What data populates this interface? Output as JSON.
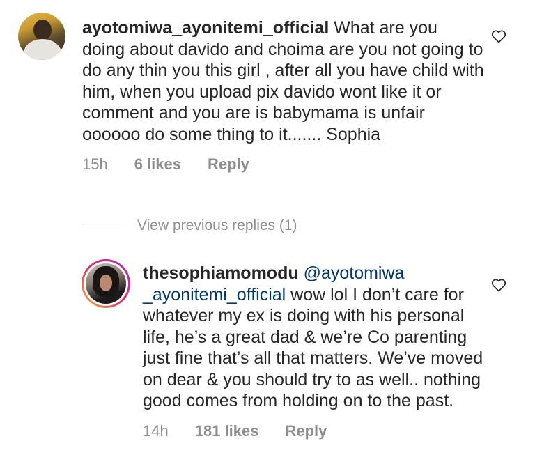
{
  "comments": [
    {
      "username": "ayotomiwa_ayonitemi_official",
      "text": "What are you doing about davido and choima are you not going to do any thin you this girl , after all you have child with him,  when you upload pix davido wont like it  or comment and you are is babymama is unfair oooooo do some thing to it....... Sophia",
      "time": "15h",
      "likes": "6 likes",
      "reply_label": "Reply",
      "avatar_icon": "profile-avatar",
      "like_icon": "heart-outline-icon"
    },
    {
      "username": "thesophiamomodu",
      "mention": "@ayotomiwa _ayonitemi_official",
      "text": "wow lol I don’t care for whatever my ex is doing with his personal life, he’s a great dad & we’re Co parenting just fine that’s all that matters. We’ve moved on dear & you should try to as well.. nothing good comes from holding on to the past.",
      "time": "14h",
      "likes": "181 likes",
      "reply_label": "Reply",
      "avatar_icon": "profile-avatar-story-ring",
      "like_icon": "heart-outline-icon"
    }
  ],
  "view_replies": {
    "label": "View previous replies (1)"
  },
  "colors": {
    "text": "#262626",
    "muted": "#8e8e8e",
    "mention": "#00376b"
  }
}
